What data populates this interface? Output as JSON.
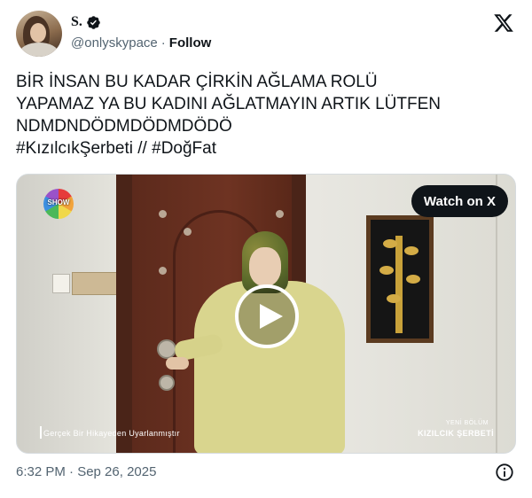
{
  "author": {
    "display_name": "S.",
    "handle": "@onlyskypace",
    "separator": "·",
    "follow_label": "Follow"
  },
  "tweet": {
    "lines": [
      "BİR İNSAN BU KADAR ÇİRKİN AĞLAMA ROLÜ",
      "YAPAMAZ YA BU KADINI AĞLATMAYIN ARTIK LÜTFEN",
      "NDMDNDÖDMDÖDMDÖDÖ"
    ],
    "hashtag_1": "#KızılcıkŞerbeti",
    "hashtag_sep": " // ",
    "hashtag_2": "#DoğFat"
  },
  "media": {
    "watch_label": "Watch on X",
    "channel_logo_text": "SHOW",
    "caption_left": "Gerçek Bir Hikayeden Uyarlanmıştır",
    "caption_right_small": "YENİ BÖLÜM",
    "caption_right": "KIZILCIK ŞERBETİ"
  },
  "footer": {
    "timestamp": "6:32 PM · Sep 26, 2025"
  },
  "icons": {
    "verified": "verified-badge-icon",
    "brand": "x-logo-icon",
    "play": "play-icon",
    "info": "info-icon"
  },
  "colors": {
    "text_primary": "#0f1419",
    "text_secondary": "#536471",
    "watch_button_bg": "#0f1419"
  }
}
